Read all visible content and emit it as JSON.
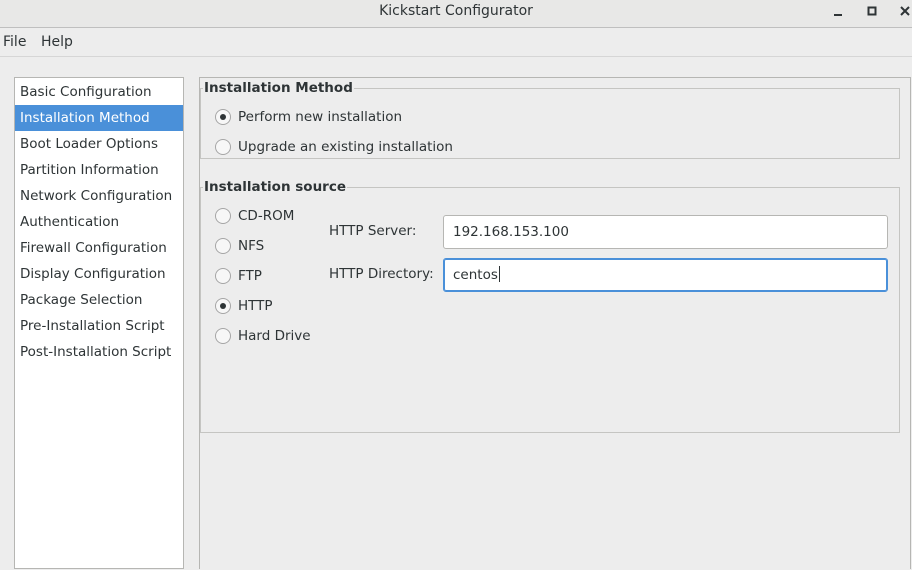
{
  "window": {
    "title": "Kickstart Configurator",
    "controls": [
      "minimize-icon",
      "maximize-icon",
      "close-icon"
    ]
  },
  "menubar": {
    "file": "File",
    "help": "Help"
  },
  "sidebar": {
    "items": [
      {
        "label": "Basic Configuration",
        "selected": false
      },
      {
        "label": "Installation Method",
        "selected": true
      },
      {
        "label": "Boot Loader Options",
        "selected": false
      },
      {
        "label": "Partition Information",
        "selected": false
      },
      {
        "label": "Network Configuration",
        "selected": false
      },
      {
        "label": "Authentication",
        "selected": false
      },
      {
        "label": "Firewall Configuration",
        "selected": false
      },
      {
        "label": "Display Configuration",
        "selected": false
      },
      {
        "label": "Package Selection",
        "selected": false
      },
      {
        "label": "Pre-Installation Script",
        "selected": false
      },
      {
        "label": "Post-Installation Script",
        "selected": false
      }
    ]
  },
  "installation_method": {
    "title": "Installation Method",
    "options": [
      {
        "label": "Perform new installation",
        "checked": true
      },
      {
        "label": "Upgrade an existing installation",
        "checked": false
      }
    ]
  },
  "installation_source": {
    "title": "Installation source",
    "options": [
      {
        "label": "CD-ROM",
        "checked": false
      },
      {
        "label": "NFS",
        "checked": false
      },
      {
        "label": "FTP",
        "checked": false
      },
      {
        "label": "HTTP",
        "checked": true
      },
      {
        "label": "Hard Drive",
        "checked": false
      }
    ],
    "http_server_label": "HTTP Server:",
    "http_server_value": "192.168.153.100",
    "http_directory_label": "HTTP Directory:",
    "http_directory_value": "centos"
  },
  "colors": {
    "selection": "#4a90d9",
    "background": "#ededed",
    "focus_border": "#4a90d9"
  }
}
